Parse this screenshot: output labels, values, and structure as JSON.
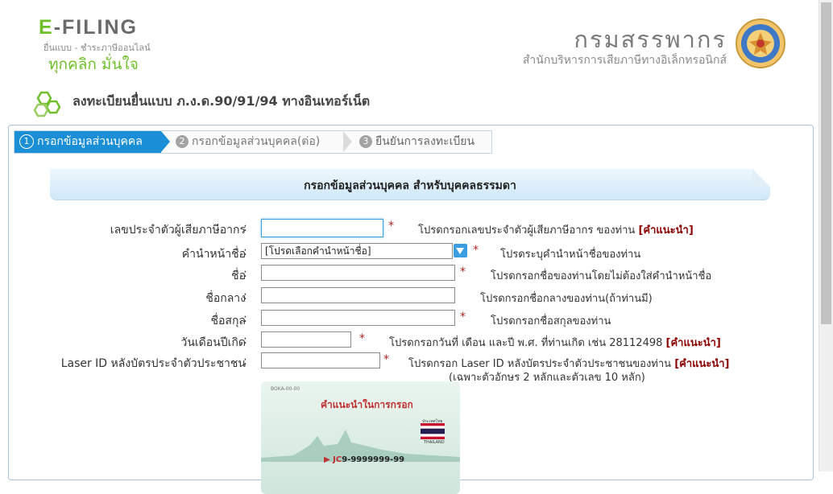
{
  "header": {
    "efiling_prefix": "E",
    "efiling_rest": "-FILING",
    "efiling_sub": "ยื่นแบบ - ชำระภาษีออนไลน์",
    "slogan": "ทุกคลิก มั่นใจ",
    "rd_title": "กรมสรรพากร",
    "rd_sub": "สำนักบริหารการเสียภาษีทางอิเล็กทรอนิกส์"
  },
  "page_heading": "ลงทะเบียนยื่นแบบ ภ.ง.ด.90/91/94 ทางอินเทอร์เน็ต",
  "steps": [
    {
      "num": "1",
      "label": "กรอกข้อมูลส่วนบุคคล"
    },
    {
      "num": "2",
      "label": "กรอกข้อมูลส่วนบุคคล(ต่อ)"
    },
    {
      "num": "3",
      "label": "ยืนยันการลงทะเบียน"
    }
  ],
  "section_title": "กรอกข้อมูลส่วนบุคคล สำหรับบุคคลธรรมดา",
  "colon": ":",
  "star": "*",
  "form": {
    "tax_id": {
      "label": "เลขประจำตัวผู้เสียภาษีอากร",
      "value": "",
      "hint": "โปรดกรอกเลขประจำตัวผู้เสียภาษีอากร ของท่าน",
      "link": "[คำแนะนำ]"
    },
    "title": {
      "label": "คำนำหน้าชื่อ",
      "selected": "[โปรดเลือกคำนำหน้าชื่อ]",
      "hint": "โปรดระบุคำนำหน้าชื่อของท่าน"
    },
    "first_name": {
      "label": "ชื่อ",
      "value": "",
      "hint": "โปรดกรอกชื่อของท่านโดยไม่ต้องใส่คำนำหน้าชื่อ"
    },
    "middle_name": {
      "label": "ชื่อกลาง",
      "value": "",
      "hint": "โปรดกรอกชื่อกลางของท่าน(ถ้าท่านมี)"
    },
    "last_name": {
      "label": "ชื่อสกุล",
      "value": "",
      "hint": "โปรดกรอกชื่อสกุลของท่าน"
    },
    "birth_date": {
      "label": "วันเดือนปีเกิด",
      "value": "",
      "hint": "โปรดกรอกวันที่ เดือน และปี พ.ศ. ที่ท่านเกิด เช่น 28112498",
      "link": "[คำแนะนำ]"
    },
    "laser_id": {
      "label": "Laser ID หลังบัตรประจำตัวประชาชน",
      "value": "",
      "hint": "โปรดกรอก Laser ID หลังบัตรประจำตัวประชาชนของท่าน",
      "link": "[คำแนะนำ]",
      "note": "(เฉพาะตัวอักษร 2 หลักและตัวเลข 10 หลัก)"
    }
  },
  "card": {
    "code": "BOKA-00-00",
    "title": "คำแนะนำในการกรอก",
    "flag_caption": "ประเทศไทย",
    "country": "THAILAND",
    "laser_prefix": "JC",
    "laser_number": "9-9999999-99",
    "colors": {
      "accent": "#c03030"
    }
  },
  "colors": {
    "brand_green": "#6fbf2a",
    "step_active": "#1a8fd6",
    "link": "#8b0000",
    "required": "#b22222"
  }
}
